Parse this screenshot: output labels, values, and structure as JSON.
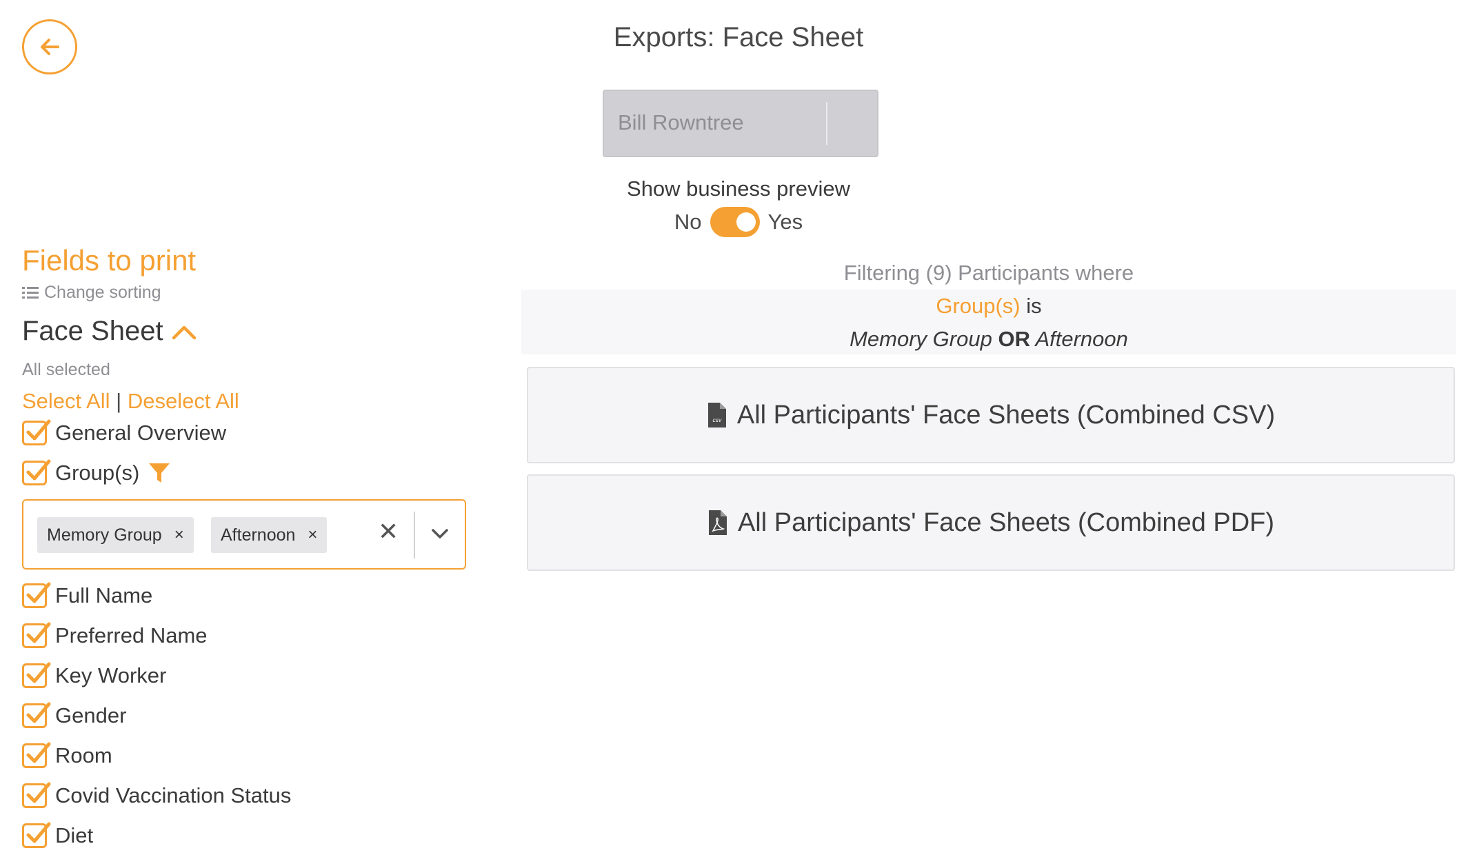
{
  "header": {
    "title": "Exports: Face Sheet"
  },
  "person": {
    "selected": "Bill Rowntree"
  },
  "preview": {
    "label": "Show business preview",
    "no_label": "No",
    "yes_label": "Yes",
    "value": "Yes"
  },
  "filter": {
    "title": "Filtering (9) Participants where",
    "field": "Group(s)",
    "op": "is",
    "value_a": "Memory Group",
    "joiner": "OR",
    "value_b": "Afternoon"
  },
  "exports": {
    "csv_label": "All Participants' Face Sheets (Combined CSV)",
    "pdf_label": "All Participants' Face Sheets (Combined PDF)"
  },
  "fields": {
    "title": "Fields to print",
    "change_sorting": "Change sorting",
    "section_title": "Face Sheet",
    "all_selected": "All selected",
    "select_all": "Select All",
    "divider": "|",
    "deselect_all": "Deselect All",
    "items": [
      {
        "label": "General Overview",
        "checked": true
      },
      {
        "label": "Group(s)",
        "checked": true
      },
      {
        "label": "Full Name",
        "checked": true
      },
      {
        "label": "Preferred Name",
        "checked": true
      },
      {
        "label": "Key Worker",
        "checked": true
      },
      {
        "label": "Gender",
        "checked": true
      },
      {
        "label": "Room",
        "checked": true
      },
      {
        "label": "Covid Vaccination Status",
        "checked": true
      },
      {
        "label": "Diet",
        "checked": true
      }
    ],
    "group_chips": [
      "Memory Group",
      "Afternoon"
    ],
    "chip_remove": "×",
    "clear_all": "✕"
  },
  "colors": {
    "accent": "#f5a033",
    "muted": "#8e8e93"
  }
}
